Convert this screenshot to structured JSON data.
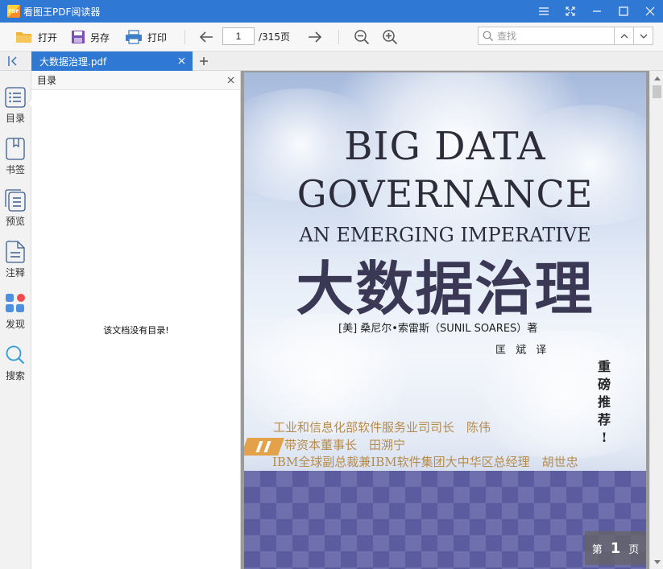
{
  "window": {
    "app_title": "看图王PDF阅读器",
    "logo_text": "PDF"
  },
  "toolbar": {
    "open_label": "打开",
    "saveas_label": "另存",
    "print_label": "打印",
    "page_current": "1",
    "page_total": "/315页",
    "search_placeholder": "查找"
  },
  "tabs": [
    {
      "label": "大数据治理.pdf"
    }
  ],
  "sidebar": {
    "items": [
      {
        "label": "目录",
        "icon": "list-icon"
      },
      {
        "label": "书签",
        "icon": "bookmark-icon"
      },
      {
        "label": "预览",
        "icon": "thumbnails-icon"
      },
      {
        "label": "注释",
        "icon": "annotation-icon"
      },
      {
        "label": "发现",
        "icon": "apps-icon"
      },
      {
        "label": "搜索",
        "icon": "search-icon"
      }
    ]
  },
  "toc": {
    "title": "目录",
    "empty_message": "该文档没有目录!"
  },
  "cover": {
    "title_line1": "BIG DATA",
    "title_line2": "GOVERNANCE",
    "subtitle": "AN EMERGING IMPERATIVE",
    "title_cn": "大数据治理",
    "author": "[美] 桑尼尔•索雷斯（SUNIL SOARES）著",
    "translator": "匡 斌 译",
    "vertical_text": "重磅推荐!",
    "rec1": "工业和信息化部软件服务业司司长　陈伟",
    "rec2": "带资本董事长　田溯宁",
    "rec3": "IBM全球副总裁兼IBM软件集团大中华区总经理　胡世忠"
  },
  "page_badge": {
    "prefix": "第",
    "number": "1",
    "suffix": "页"
  },
  "colors": {
    "accent": "#2f78d4",
    "toolbar_bg": "#f7f7f7",
    "doc_bg": "#9b9b9b"
  }
}
